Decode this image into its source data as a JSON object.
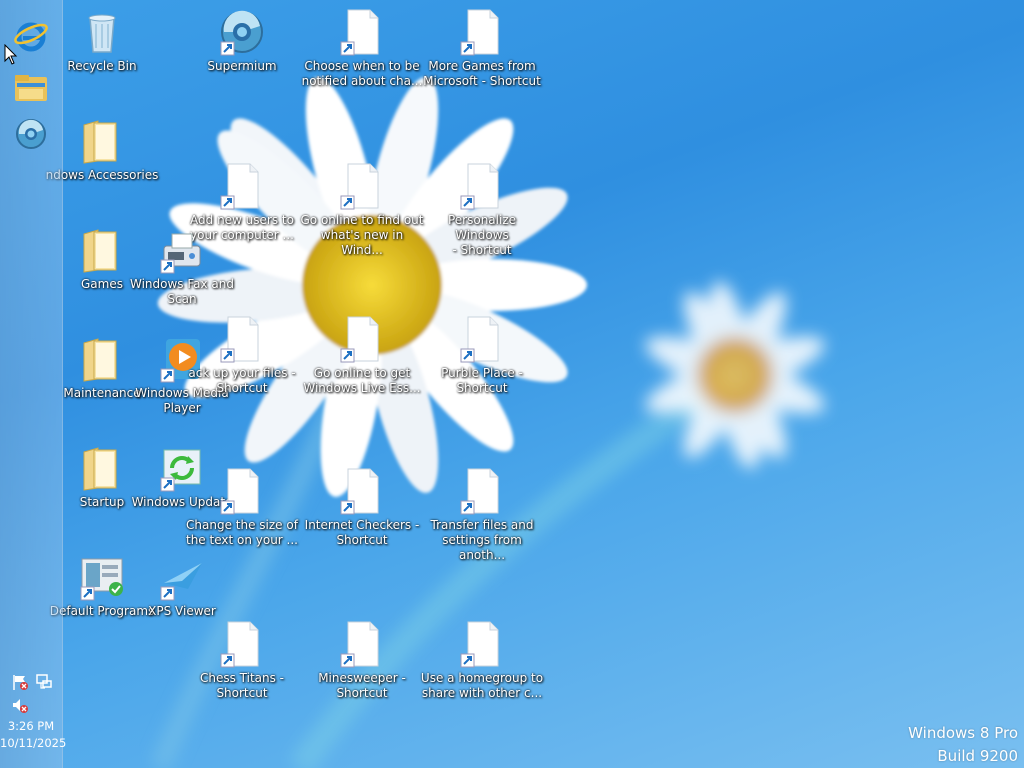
{
  "colors": {
    "wallpaper": "#3d9fe8",
    "taskbar": "#8fb8de",
    "text": "#ffffff"
  },
  "taskbar": {
    "pinned": [
      "internet-explorer-icon",
      "file-explorer-icon",
      "supermium-icon"
    ],
    "tray": [
      "action-center-flag-icon",
      "network-icon",
      "volume-muted-icon"
    ],
    "clock": {
      "time": "3:26 PM",
      "date": "10/11/2025"
    }
  },
  "desktop": {
    "icons": [
      {
        "label": "Recycle Bin",
        "icon": "recycle-bin-icon"
      },
      {
        "label": "Supermium",
        "icon": "supermium-icon"
      },
      {
        "label": "Choose when to be\nnotified about cha...",
        "icon": "document-shortcut-icon"
      },
      {
        "label": "More Games from\nMicrosoft - Shortcut",
        "icon": "document-shortcut-icon"
      },
      {
        "label": "ndows Accessories",
        "icon": "folder-icon"
      },
      {
        "label": "Add new users to\nyour computer ...",
        "icon": "document-shortcut-icon"
      },
      {
        "label": "Go online to find out\nwhat's new in Wind...",
        "icon": "document-shortcut-icon"
      },
      {
        "label": "Personalize Windows\n- Shortcut",
        "icon": "document-shortcut-icon"
      },
      {
        "label": "Games",
        "icon": "folder-icon"
      },
      {
        "label": "Windows Fax and\nScan",
        "icon": "fax-icon"
      },
      {
        "label": "Maintenance",
        "icon": "folder-icon"
      },
      {
        "label": "Windows Media\nPlayer",
        "icon": "media-player-icon"
      },
      {
        "label": "ack up your files -\nShortcut",
        "icon": "document-shortcut-icon"
      },
      {
        "label": "Go online to get\nWindows Live Ess...",
        "icon": "document-shortcut-icon"
      },
      {
        "label": "Purble Place -\nShortcut",
        "icon": "document-shortcut-icon"
      },
      {
        "label": "Startup",
        "icon": "folder-icon"
      },
      {
        "label": "Windows Update",
        "icon": "windows-update-icon"
      },
      {
        "label": "Change the size of\nthe text on your ...",
        "icon": "document-shortcut-icon"
      },
      {
        "label": "Internet Checkers -\nShortcut",
        "icon": "document-shortcut-icon"
      },
      {
        "label": "Transfer files and\nsettings from anoth...",
        "icon": "document-shortcut-icon"
      },
      {
        "label": "Default Programs",
        "icon": "default-programs-icon"
      },
      {
        "label": "XPS Viewer",
        "icon": "xps-viewer-icon"
      },
      {
        "label": "Chess Titans -\nShortcut",
        "icon": "document-shortcut-icon"
      },
      {
        "label": "Minesweeper -\nShortcut",
        "icon": "document-shortcut-icon"
      },
      {
        "label": "Use a homegroup to\nshare with other c...",
        "icon": "document-shortcut-icon"
      }
    ]
  },
  "watermark": {
    "line1": "Windows 8 Pro",
    "line2": "Build 9200"
  }
}
